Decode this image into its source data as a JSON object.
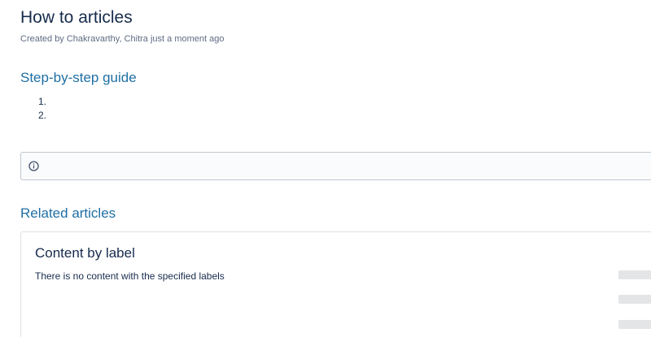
{
  "page": {
    "title": "How to articles",
    "byline": "Created by Chakravarthy, Chitra just a moment ago"
  },
  "steps_section": {
    "heading": "Step-by-step guide",
    "items": [
      "1.",
      "2."
    ]
  },
  "info_panel": {
    "icon": "info-icon",
    "text": ""
  },
  "related_section": {
    "heading": "Related articles",
    "macro": {
      "title": "Content by label",
      "empty_message": "There is no content with the specified labels"
    }
  },
  "colors": {
    "heading_link": "#1f6fa5",
    "text": "#172b4d",
    "meta": "#5e6c84",
    "panel_border": "#c1c7d0",
    "skeleton": "#e4e5e7"
  }
}
